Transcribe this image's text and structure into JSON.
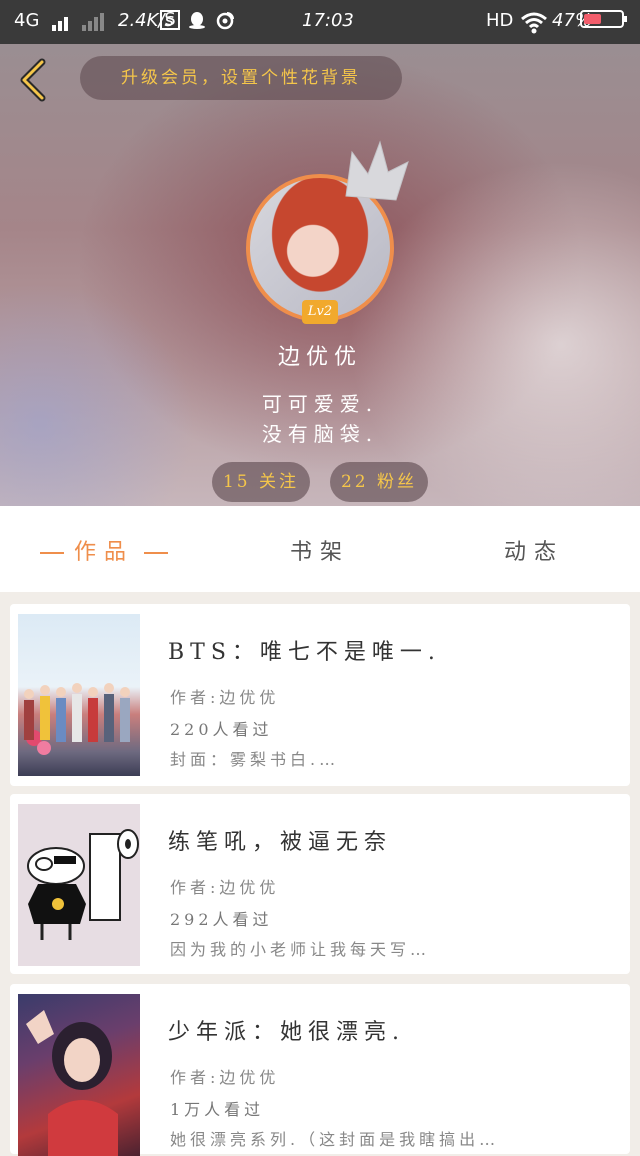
{
  "status_bar": {
    "network": "4G",
    "speed": "2.4K/s",
    "time": "17:03",
    "hd": "HD",
    "battery": "47%",
    "battery_level": 0.47,
    "icons": [
      "signal-icon",
      "s-app-icon",
      "qq-icon",
      "weibo-icon",
      "wifi-icon",
      "battery-icon"
    ]
  },
  "header": {
    "notice": "升级会员，设置个性花背景",
    "level": "Lv2",
    "username": "边优优",
    "bio_line1": "可可爱爱.",
    "bio_line2": "没有脑袋.",
    "following": "15 关注",
    "fans": "22 粉丝",
    "accent": "#ef8e4b",
    "gold": "#f5c64a"
  },
  "tabs": {
    "works": "作品",
    "shelf": "书架",
    "feed": "动态"
  },
  "works": [
    {
      "title": "BTS：唯七不是唯一.",
      "author": "作者:边优优",
      "views": "220人看过",
      "desc": "封面：雾梨书白.…"
    },
    {
      "title": "练笔吼，被逼无奈",
      "author": "作者:边优优",
      "views": "292人看过",
      "desc": "因为我的小老师让我每天写…"
    },
    {
      "title": "少年派：她很漂亮.",
      "author": "作者:边优优",
      "views": "1万人看过",
      "desc": "她很漂亮系列.（这封面是我瞎搞出…"
    }
  ]
}
